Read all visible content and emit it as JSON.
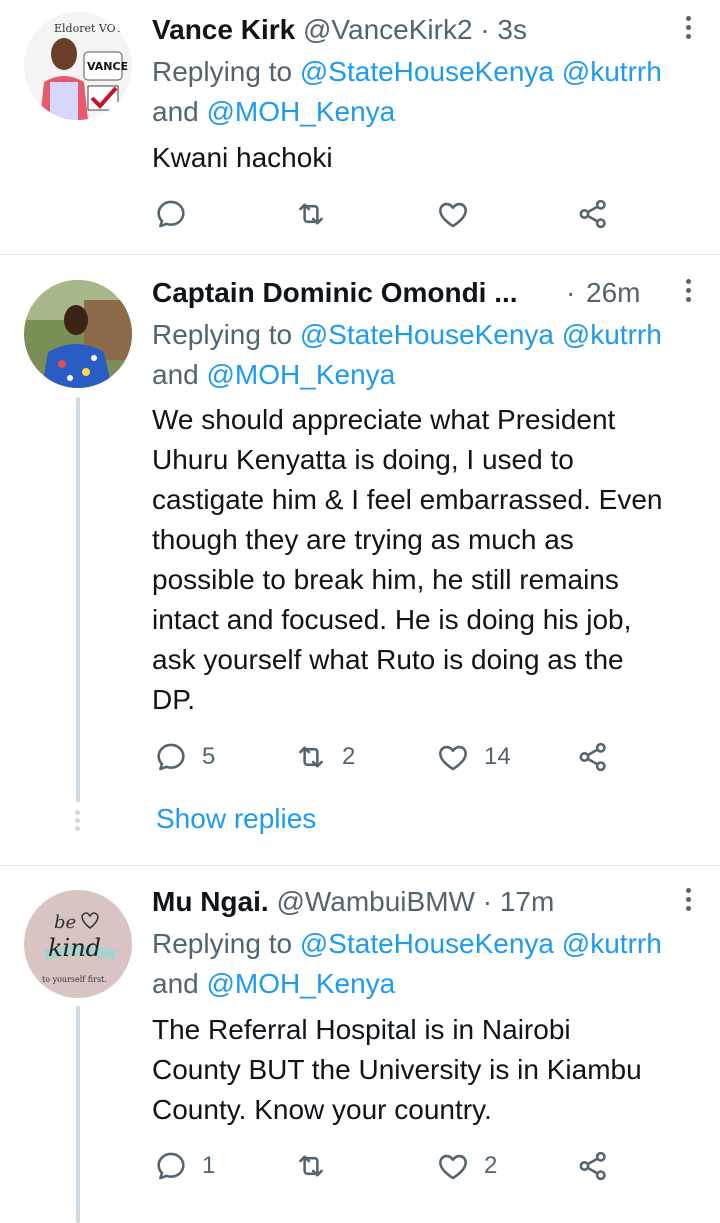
{
  "colors": {
    "link": "#1d9bf0",
    "muted": "#536471",
    "text": "#0f1419",
    "divider": "#e1e8ed"
  },
  "tweets": [
    {
      "avatar_icon": "avatar-vance-kirk-campaign-poster",
      "avatar_text": [
        "Eldoret VOT",
        "VANCE"
      ],
      "name": "Vance Kirk",
      "handle": "@VanceKirk2",
      "dot": "·",
      "time": "3s",
      "replying_prefix": "Replying to ",
      "mention1": "@StateHouseKenya",
      "mention2": "@kutrrh",
      "and": "and ",
      "mention3": "@MOH_Kenya",
      "text": "Kwani hachoki",
      "reply_count": "",
      "retweet_count": "",
      "like_count": ""
    },
    {
      "avatar_icon": "avatar-man-blue-shirt",
      "name": "Captain Dominic Omondi ...",
      "handle": "",
      "dot": "·",
      "time": "26m",
      "replying_prefix": "Replying to ",
      "mention1": "@StateHouseKenya",
      "mention2": "@kutrrh",
      "and": "and ",
      "mention3": "@MOH_Kenya",
      "text_lines": [
        "We should appreciate what President",
        "Uhuru Kenyatta is doing, I used to",
        "castigate him & I feel embarrassed. Even",
        "though they are trying as much as",
        "possible to break him, he still remains",
        "intact and focused. He is doing his job,",
        "ask yourself what Ruto is doing as the",
        "DP."
      ],
      "reply_count": "5",
      "retweet_count": "2",
      "like_count": "14",
      "show_replies": "Show replies"
    },
    {
      "avatar_icon": "avatar-be-kind",
      "avatar_text": [
        "be",
        "kind",
        "to yourself first."
      ],
      "name": "Mu Ngai.",
      "handle": "@WambuiBMW",
      "dot": "·",
      "time": "17m",
      "replying_prefix": "Replying to ",
      "mention1": "@StateHouseKenya",
      "mention2": "@kutrrh",
      "and": "and ",
      "mention3": "@MOH_Kenya",
      "text_lines": [
        "The Referral Hospital is in Nairobi",
        "County BUT the University is in Kiambu",
        "County. Know your country."
      ],
      "reply_count": "1",
      "retweet_count": "",
      "like_count": "2"
    }
  ]
}
